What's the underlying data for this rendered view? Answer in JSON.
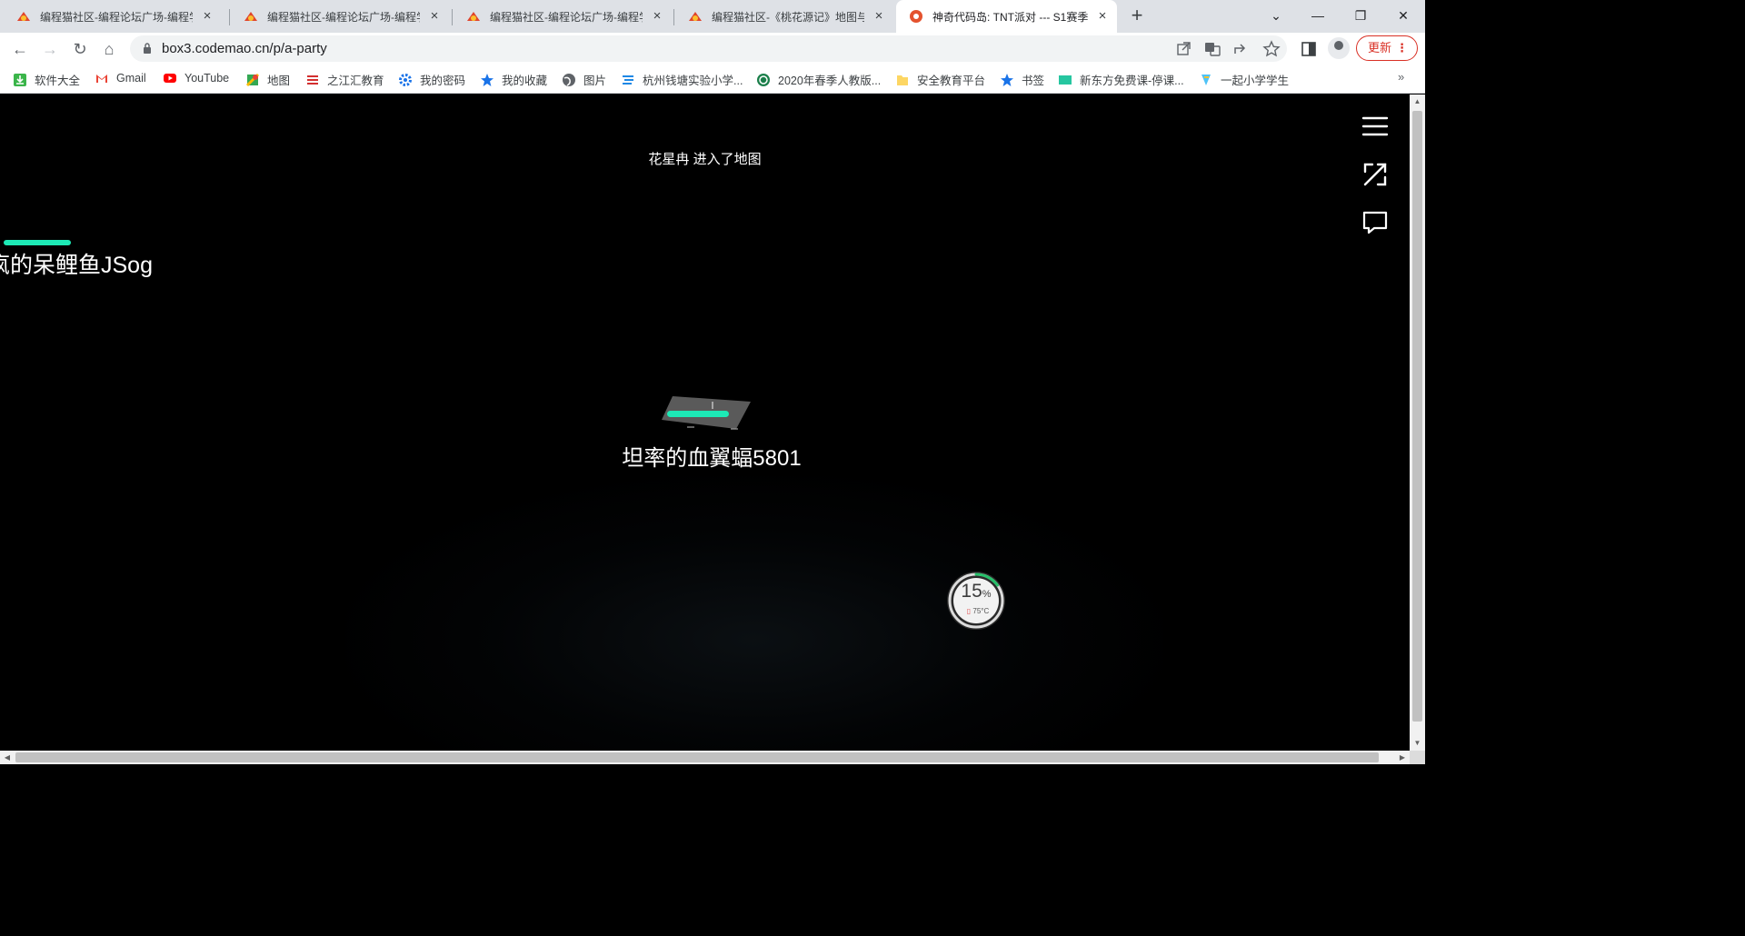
{
  "browser": {
    "tabs": [
      {
        "title": "编程猫社区-编程论坛广场-编程学",
        "active": false
      },
      {
        "title": "编程猫社区-编程论坛广场-编程学",
        "active": false
      },
      {
        "title": "编程猫社区-编程论坛广场-编程学",
        "active": false
      },
      {
        "title": "编程猫社区-《桃花源记》地图与",
        "active": false
      },
      {
        "title": "神奇代码岛: TNT派对 --- S1赛季",
        "active": true
      }
    ],
    "tab_close": "×",
    "new_tab": "+",
    "window_controls": {
      "tab_search": "⌄",
      "minimize": "—",
      "restore": "❐",
      "close": "✕"
    },
    "nav": {
      "back": "←",
      "forward": "→",
      "reload": "↻",
      "home": "⌂"
    },
    "address": "box3.codemao.cn/p/a-party",
    "update_label": "更新",
    "update_menu": "⋮"
  },
  "bookmarks": {
    "items": [
      {
        "label": "软件大全",
        "icon": "download-icon"
      },
      {
        "label": "Gmail",
        "icon": "gmail-icon"
      },
      {
        "label": "YouTube",
        "icon": "youtube-icon"
      },
      {
        "label": "地图",
        "icon": "maps-icon"
      },
      {
        "label": "之江汇教育",
        "icon": "zjh-icon"
      },
      {
        "label": "我的密码",
        "icon": "gear-icon"
      },
      {
        "label": "我的收藏",
        "icon": "star-icon"
      },
      {
        "label": "图片",
        "icon": "globe-icon"
      },
      {
        "label": "杭州钱塘实验小学...",
        "icon": "school-icon"
      },
      {
        "label": "2020年春季人教版...",
        "icon": "pep-icon"
      },
      {
        "label": "安全教育平台",
        "icon": "folder-icon"
      },
      {
        "label": "书签",
        "icon": "star-icon"
      },
      {
        "label": "新东方免费课-停课...",
        "icon": "xdf-icon"
      },
      {
        "label": "一起小学学生",
        "icon": "yiqi-icon"
      }
    ],
    "more": "»"
  },
  "game": {
    "notice": "花星冉 进入了地图",
    "other_player_name": "疯的呆鲤鱼JSog",
    "player_name": "坦率的血翼蝠5801",
    "gauge": {
      "percent": "15",
      "percent_sign": "%",
      "temperature": "75°C",
      "fraction": 0.15
    },
    "colors": {
      "health": "#1de9b6",
      "gauge_ring": "#26c06a",
      "background": "#000000"
    }
  }
}
